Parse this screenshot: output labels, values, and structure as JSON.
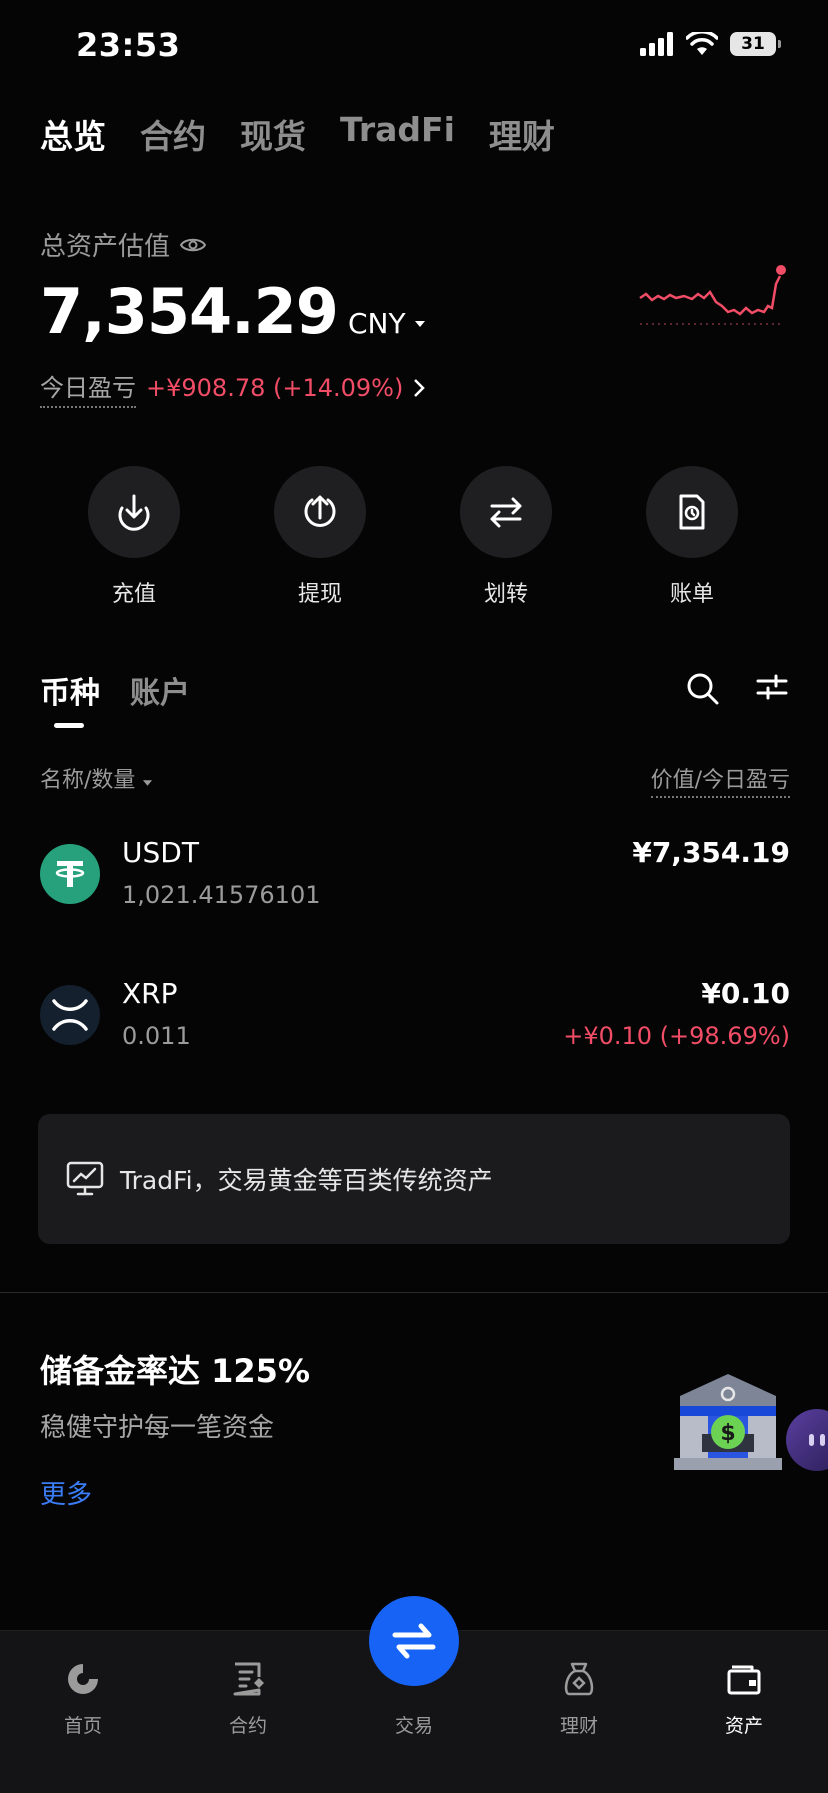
{
  "status": {
    "time": "23:53",
    "battery": "31"
  },
  "top_tabs": [
    {
      "label": "总览",
      "active": true
    },
    {
      "label": "合约",
      "active": false
    },
    {
      "label": "现货",
      "active": false
    },
    {
      "label": "TradFi",
      "active": false
    },
    {
      "label": "理财",
      "active": false
    }
  ],
  "asset": {
    "label": "总资产估值",
    "value": "7,354.29",
    "currency": "CNY",
    "pnl_label": "今日盈亏",
    "pnl_value": "+¥908.78 (+14.09%)"
  },
  "actions": [
    {
      "label": "充值",
      "icon": "deposit-icon"
    },
    {
      "label": "提现",
      "icon": "withdraw-icon"
    },
    {
      "label": "划转",
      "icon": "transfer-icon"
    },
    {
      "label": "账单",
      "icon": "bill-icon"
    }
  ],
  "sub_tabs": [
    {
      "label": "币种",
      "active": true
    },
    {
      "label": "账户",
      "active": false
    }
  ],
  "list_header": {
    "left": "名称/数量",
    "right": "价值/今日盈亏"
  },
  "coins": [
    {
      "symbol": "USDT",
      "quantity": "1,021.41576101",
      "value": "¥7,354.19",
      "pnl": ""
    },
    {
      "symbol": "XRP",
      "quantity": "0.011",
      "value": "¥0.10",
      "pnl": "+¥0.10 (+98.69%)"
    }
  ],
  "tradfi_banner": "TradFi，交易黄金等百类传统资产",
  "reserve": {
    "title": "储备金率达 125%",
    "subtitle": "稳健守护每一笔资金",
    "more": "更多"
  },
  "bottom_nav": [
    {
      "label": "首页",
      "icon": "home-icon",
      "active": false
    },
    {
      "label": "合约",
      "icon": "contract-icon",
      "active": false
    },
    {
      "label": "交易",
      "icon": "trade-icon",
      "active": false
    },
    {
      "label": "理财",
      "icon": "earn-icon",
      "active": false
    },
    {
      "label": "资产",
      "icon": "wallet-icon",
      "active": true
    }
  ],
  "colors": {
    "accent": "#1763f5",
    "gain": "#f24d67",
    "link": "#3b7df7",
    "usdt": "#26a17b"
  }
}
